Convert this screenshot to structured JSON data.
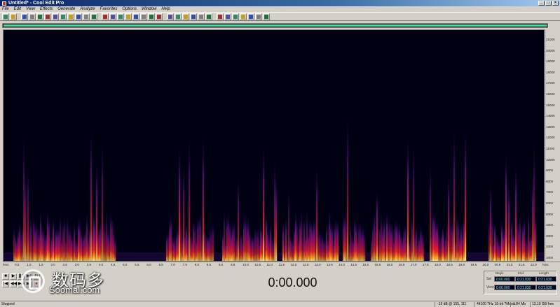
{
  "window": {
    "title": "Untitled* - Cool Edit Pro"
  },
  "menu": [
    "File",
    "Edit",
    "View",
    "Effects",
    "Generate",
    "Analyze",
    "Favorites",
    "Options",
    "Window",
    "Help"
  ],
  "toolbar": {
    "icons": [
      "waveform-view-icon",
      "multitrack-icon",
      "new-file-icon",
      "open-file-icon",
      "save-icon",
      "cut-icon",
      "copy-icon",
      "paste-icon",
      "paste-new-icon",
      "mix-paste-icon",
      "trim-icon",
      "undo-icon",
      "repeat-icon",
      "zoom-in-icon",
      "zoom-out-icon",
      "zoom-full-icon",
      "zoom-selection-icon",
      "zoom-left-icon",
      "zoom-right-icon",
      "zoom-vertical-icon",
      "snap-icon",
      "spectral-view-icon",
      "waveform-toggle-icon",
      "loop-icon",
      "marker-icon",
      "noise-icon",
      "envelope-icon",
      "analysis-icon",
      "frequency-icon",
      "batch-icon",
      "scripts-icon",
      "cue-list-icon",
      "play-list-icon"
    ],
    "accent": "#2a8a6a"
  },
  "overview_color": "#3fd6a0",
  "spectrogram": {
    "background": "#000013",
    "y_ticks": [
      "21000",
      "20000",
      "19000",
      "18000",
      "17000",
      "16000",
      "15000",
      "14000",
      "13000",
      "12000",
      "11000",
      "10000",
      "9000",
      "8000",
      "7000",
      "6000",
      "5000",
      "4000",
      "3000",
      "2000",
      "1000"
    ],
    "x_ticks": [
      "hms",
      "0.5",
      "1.0",
      "1.5",
      "2.0",
      "2.5",
      "3.0",
      "3.5",
      "4.0",
      "4.5",
      "5.0",
      "5.5",
      "6.0",
      "6.5",
      "7.0",
      "7.5",
      "8.0",
      "8.5",
      "9.0",
      "9.5",
      "10.0",
      "10.5",
      "11.0",
      "11.5",
      "12.0",
      "12.5",
      "13.0",
      "13.5",
      "14.0",
      "14.5",
      "15.0",
      "15.5",
      "16.0",
      "16.5",
      "17.0",
      "17.5",
      "18.0",
      "18.5",
      "19.0",
      "19.5",
      "20.0",
      "20.5",
      "21.0",
      "21.5",
      "22.0",
      "hms"
    ]
  },
  "transport": {
    "buttons": [
      "stop-icon",
      "play-icon",
      "pause-icon",
      "play-to-end-icon",
      "loop-play-icon",
      "go-start-icon",
      "rewind-icon",
      "fast-forward-icon",
      "go-end-icon",
      "record-icon"
    ]
  },
  "watermark": {
    "cn": "数码多",
    "en": "Soomal.com"
  },
  "time_display": "0:00.000",
  "selection": {
    "headers": [
      "Begin",
      "End",
      "Length"
    ],
    "rows": [
      {
        "label": "Sel",
        "begin": "0:00.000",
        "end": "0:21.030",
        "length": "0:21.030"
      },
      {
        "label": "View",
        "begin": "0:00.000",
        "end": "0:21.030",
        "length": "0:21.030"
      }
    ]
  },
  "status": {
    "state": "Stopped",
    "cursor": "-19 dB @ 155, 111",
    "format": "44100 ?Hz 16-bit ?Mono",
    "size": "1.84 Mb",
    "free": "13.10 GB free"
  }
}
